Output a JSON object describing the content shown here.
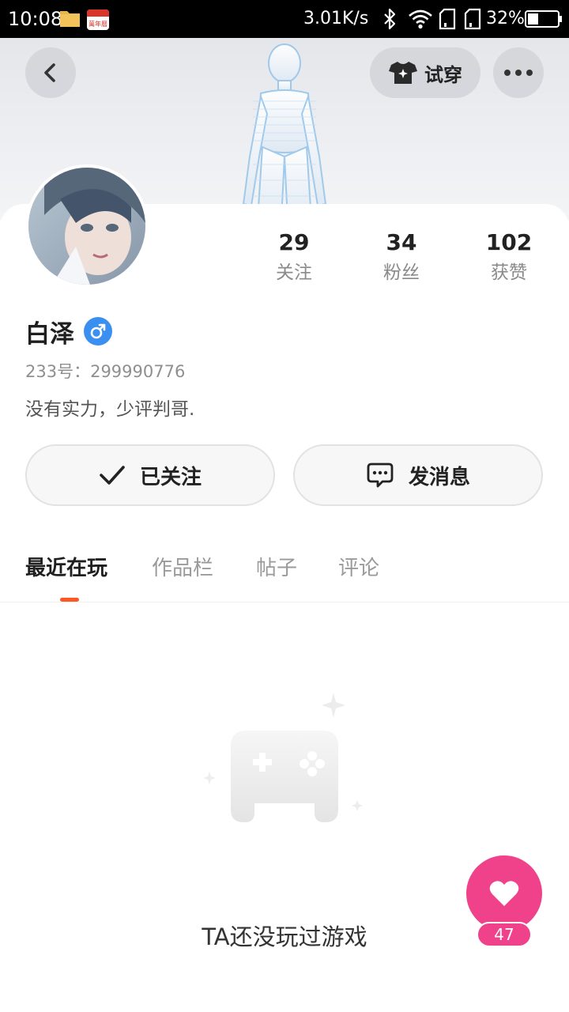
{
  "status_bar": {
    "time": "10:08",
    "network_speed": "3.01K/s",
    "battery": "32%",
    "calendar_text": "萬年曆"
  },
  "header": {
    "tryon_label": "试穿"
  },
  "profile": {
    "username": "白泽",
    "gender_symbol": "♂",
    "uid": "233号：299990776",
    "bio": "没有实力，少评判哥.",
    "stats": [
      {
        "value": "29",
        "label": "关注"
      },
      {
        "value": "34",
        "label": "粉丝"
      },
      {
        "value": "102",
        "label": "获赞"
      }
    ]
  },
  "actions": {
    "follow_label": "已关注",
    "message_label": "发消息"
  },
  "tabs": [
    {
      "label": "最近在玩",
      "active": true
    },
    {
      "label": "作品栏",
      "active": false
    },
    {
      "label": "帖子",
      "active": false
    },
    {
      "label": "评论",
      "active": false
    }
  ],
  "empty_state": {
    "text": "TA还没玩过游戏"
  },
  "like_fab": {
    "count": "47"
  },
  "colors": {
    "accent": "#ff5722",
    "like_pink": "#f0428a",
    "gender_blue": "#3a8ff0"
  }
}
